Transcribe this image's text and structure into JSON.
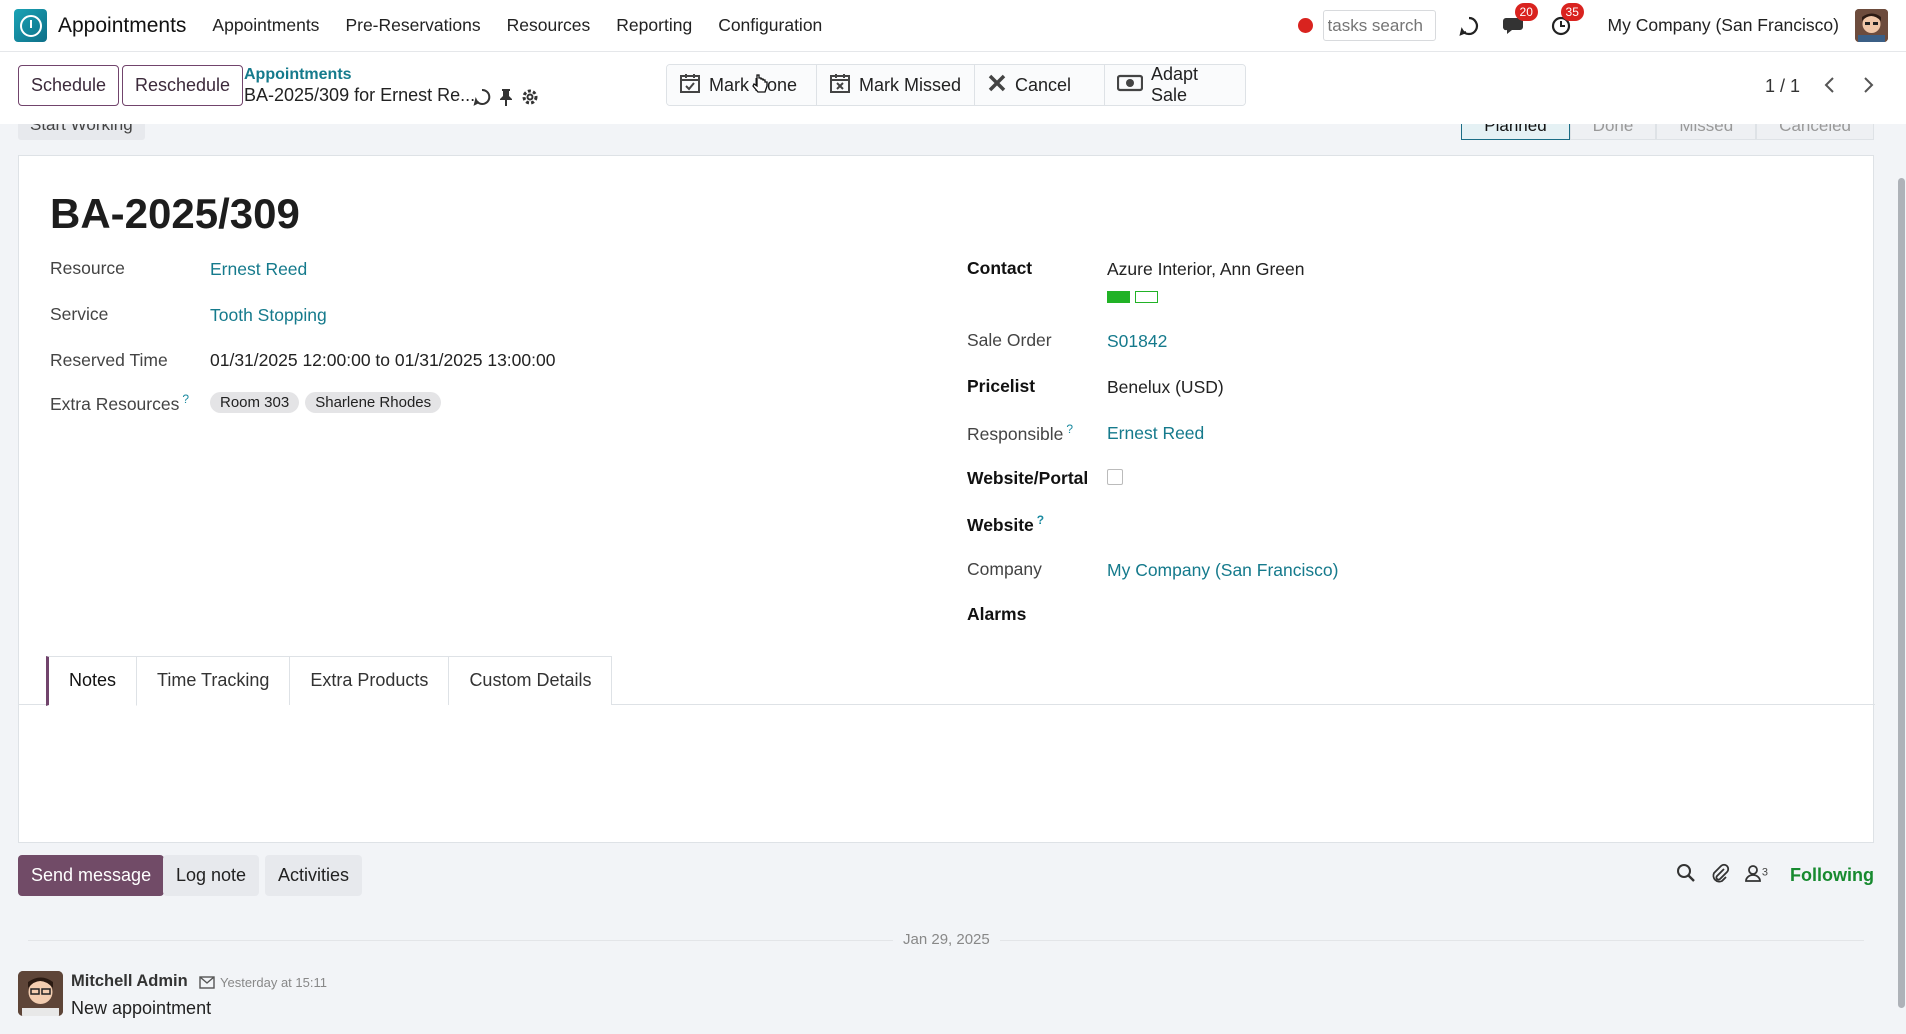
{
  "navbar": {
    "app_name": "Appointments",
    "menu": [
      "Appointments",
      "Pre-Reservations",
      "Resources",
      "Reporting",
      "Configuration"
    ],
    "search_placeholder": "tasks search",
    "messages_badge": "20",
    "activities_badge": "35",
    "company": "My Company (San Francisco)"
  },
  "control": {
    "schedule": "Schedule",
    "reschedule": "Reschedule",
    "breadcrumb_parent": "Appointments",
    "breadcrumb_current": "BA-2025/309 for Ernest Re...",
    "actions": [
      "Mark Done",
      "Mark Missed",
      "Cancel",
      "Adapt Sale"
    ],
    "pager": "1 / 1"
  },
  "status": {
    "start_working": "Start Working",
    "stages": [
      "Planned",
      "Done",
      "Missed",
      "Canceled"
    ],
    "active_stage": "Planned"
  },
  "record": {
    "title": "BA-2025/309",
    "left": {
      "resource_label": "Resource",
      "resource": "Ernest Reed",
      "service_label": "Service",
      "service": "Tooth Stopping",
      "reserved_label": "Reserved Time",
      "reserved": "01/31/2025 12:00:00 to 01/31/2025 13:00:00",
      "extra_label": "Extra Resources",
      "extra_help": "?",
      "extra_tags": [
        "Room 303",
        "Sharlene Rhodes"
      ]
    },
    "right": {
      "contact_label": "Contact",
      "contact": "Azure Interior, Ann Green",
      "sale_order_label": "Sale Order",
      "sale_order": "S01842",
      "pricelist_label": "Pricelist",
      "pricelist": "Benelux (USD)",
      "responsible_label": "Responsible",
      "responsible_help": "?",
      "responsible": "Ernest Reed",
      "portal_label": "Website/Portal",
      "website_label": "Website",
      "website_help": "?",
      "company_label": "Company",
      "company": "My Company (San Francisco)",
      "alarms_label": "Alarms"
    },
    "tabs": [
      "Notes",
      "Time Tracking",
      "Extra Products",
      "Custom Details"
    ]
  },
  "chatter": {
    "send_message": "Send message",
    "log_note": "Log note",
    "activities": "Activities",
    "followers_count": "3",
    "following": "Following",
    "date": "Jan 29, 2025",
    "message": {
      "author": "Mitchell Admin",
      "time": "Yesterday at 15:11",
      "body": "New appointment"
    }
  },
  "colors": {
    "brand": "#714b67",
    "link": "#157a8c",
    "badge": "#d9231f",
    "following": "#178a2f"
  }
}
